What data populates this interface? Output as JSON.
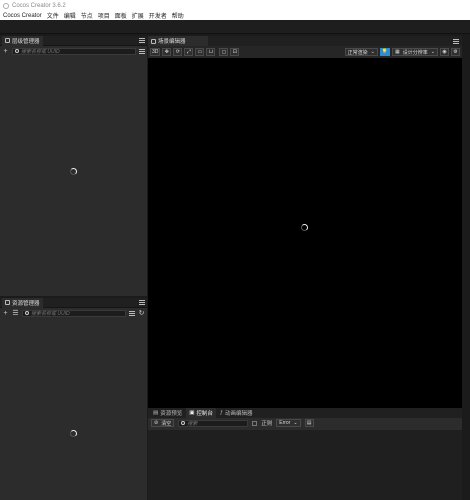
{
  "window": {
    "title": "Cocos Creator 3.6.2"
  },
  "menubar": {
    "items": [
      "Cocos Creator",
      "文件",
      "编辑",
      "节点",
      "项目",
      "面板",
      "扩展",
      "开发者",
      "帮助"
    ]
  },
  "hierarchy": {
    "tab_label": "层级管理器",
    "search_placeholder": "搜索名称或 UUID"
  },
  "assets": {
    "tab_label": "资源管理器",
    "search_placeholder": "搜索名称或 UUID"
  },
  "scene": {
    "tab_label": "场景编辑器",
    "view_mode": "3D",
    "render_mode": "正常渲染",
    "resolution": "设计分辨率"
  },
  "console": {
    "tabs": [
      "资源预览",
      "控制台",
      "动画编辑器"
    ],
    "active_tab": 1,
    "clear_label": "清空",
    "search_placeholder": "搜索",
    "regex_label": "正则",
    "level_filter": "Error"
  }
}
